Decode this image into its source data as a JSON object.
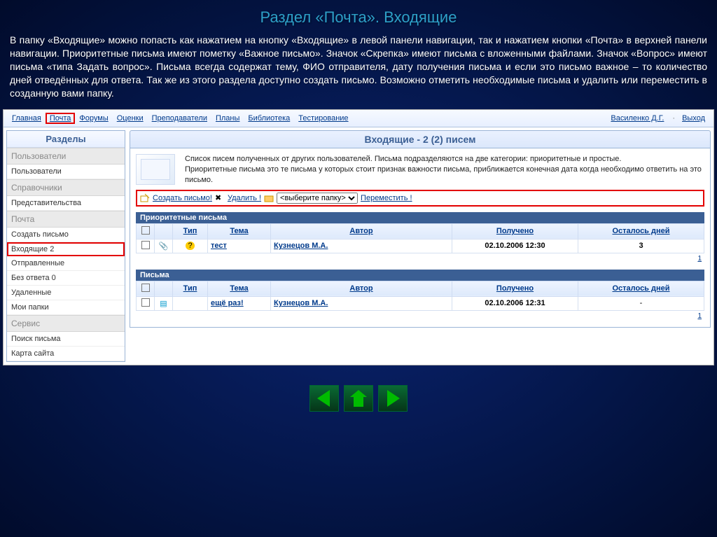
{
  "slide": {
    "title": "Раздел «Почта». Входящие",
    "description": "В папку «Входящие» можно попасть как нажатием на кнопку «Входящие» в левой панели навигации, так и нажатием кнопки «Почта» в верхней панели навигации. Приоритетные письма имеют пометку «Важное письмо». Значок «Скрепка» имеют письма с вложенными файлами. Значок «Вопрос» имеют письма «типа Задать вопрос». Письма всегда содержат тему, ФИО отправителя, дату получения письма и если это письмо важное – то количество дней отведённых для ответа. Так же из этого раздела доступно создать письмо. Возможно отметить необходимые письма  и удалить или переместить в созданную вами папку."
  },
  "topnav": {
    "items": [
      "Главная",
      "Почта",
      "Форумы",
      "Оценки",
      "Преподаватели",
      "Планы",
      "Библиотека",
      "Тестирование"
    ],
    "user": "Василенко Д.Г.",
    "logout": "Выход"
  },
  "sidebar": {
    "title": "Разделы",
    "groups": [
      {
        "header": "Пользователи",
        "items": [
          "Пользователи"
        ]
      },
      {
        "header": "Справочники",
        "items": [
          "Представительства"
        ]
      },
      {
        "header": "Почта",
        "items": [
          "Создать письмо",
          "Входящие 2",
          "Отправленные",
          "Без ответа 0",
          "Удаленные",
          "Мои папки"
        ]
      },
      {
        "header": "Сервис",
        "items": [
          "Поиск письма",
          "Карта сайта"
        ]
      }
    ]
  },
  "panel": {
    "title": "Входящие - 2 (2) писем",
    "desc": "Список писем полученных от других пользователей. Письма подразделяются на две категории: приоритетные и простые.\nПриоритетные письма это те письма у которых стоит признак важности письма, приближается конечная дата когда необходимо ответить на это письмо."
  },
  "toolbar": {
    "create": "Создать письмо!",
    "delete": "Удалить !",
    "select_placeholder": "<выберите папку>",
    "move": "Переместить !"
  },
  "tables": {
    "cols": {
      "type": "Тип",
      "subject": "Тема",
      "author": "Автор",
      "received": "Получено",
      "days": "Осталось дней"
    },
    "priority": {
      "header": "Приоритетные письма",
      "rows": [
        {
          "subject": "тест",
          "author": "Кузнецов М.А.",
          "received": "02.10.2006 12:30",
          "days": "3",
          "attach": true,
          "question": true
        }
      ],
      "page": "1"
    },
    "regular": {
      "header": "Письма",
      "rows": [
        {
          "subject": "ещё раз!",
          "author": "Кузнецов М.А.",
          "received": "02.10.2006 12:31",
          "days": "-",
          "doc": true
        }
      ],
      "page": "1"
    }
  }
}
